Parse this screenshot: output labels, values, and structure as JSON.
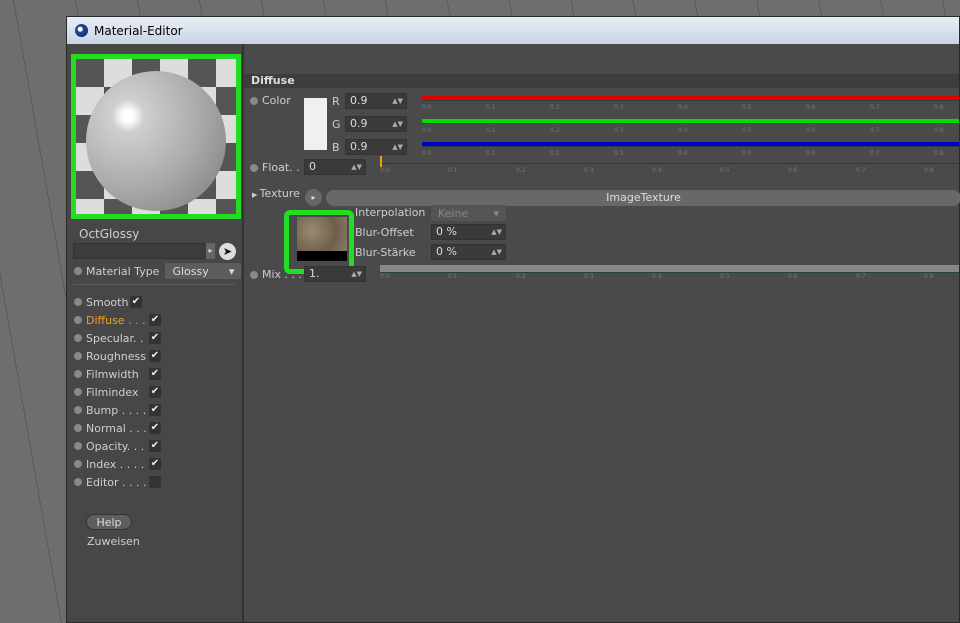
{
  "window": {
    "title": "Material-Editor"
  },
  "left": {
    "material_name": "OctGlossy",
    "material_type_label": "Material Type",
    "material_type_value": "Glossy",
    "channels": [
      {
        "label": "Smooth",
        "checked": true
      },
      {
        "label": "Diffuse . . .",
        "checked": true,
        "active": true
      },
      {
        "label": "Specular. .",
        "checked": true
      },
      {
        "label": "Roughness",
        "checked": true
      },
      {
        "label": "Filmwidth",
        "checked": true
      },
      {
        "label": "Filmindex",
        "checked": true
      },
      {
        "label": "Bump . . . .",
        "checked": true
      },
      {
        "label": "Normal . . .",
        "checked": true
      },
      {
        "label": "Opacity. . .",
        "checked": true
      },
      {
        "label": "Index . . . .",
        "checked": true
      },
      {
        "label": "Editor . . . .",
        "checked": false
      }
    ],
    "help": "Help",
    "assign": "Zuweisen"
  },
  "diffuse": {
    "header": "Diffuse",
    "color_label": "Color",
    "r_label": "R",
    "g_label": "G",
    "b_label": "B",
    "r": "0.9",
    "g": "0.9",
    "b": "0.9",
    "float_label": "Float. .",
    "float_value": "0",
    "texture_label": "Texture",
    "texture_name": "ImageTexture",
    "interpolation_label": "Interpolation",
    "interpolation_value": "Keine",
    "blur_offset_label": "Blur-Offset",
    "blur_offset": "0 %",
    "blur_strength_label": "Blur-Stärke",
    "blur_strength": "0 %",
    "mix_label": "Mix . . .",
    "mix_value": "1.",
    "ticks": [
      "0.0",
      "0.1",
      "0.2",
      "0.3",
      "0.4",
      "0.5",
      "0.6",
      "0.7",
      "0.8"
    ],
    "colors": {
      "r": "#e00000",
      "g": "#00dd00",
      "b": "#0000cc",
      "float_marker": "#f0a000",
      "active": "#f0a030"
    }
  }
}
